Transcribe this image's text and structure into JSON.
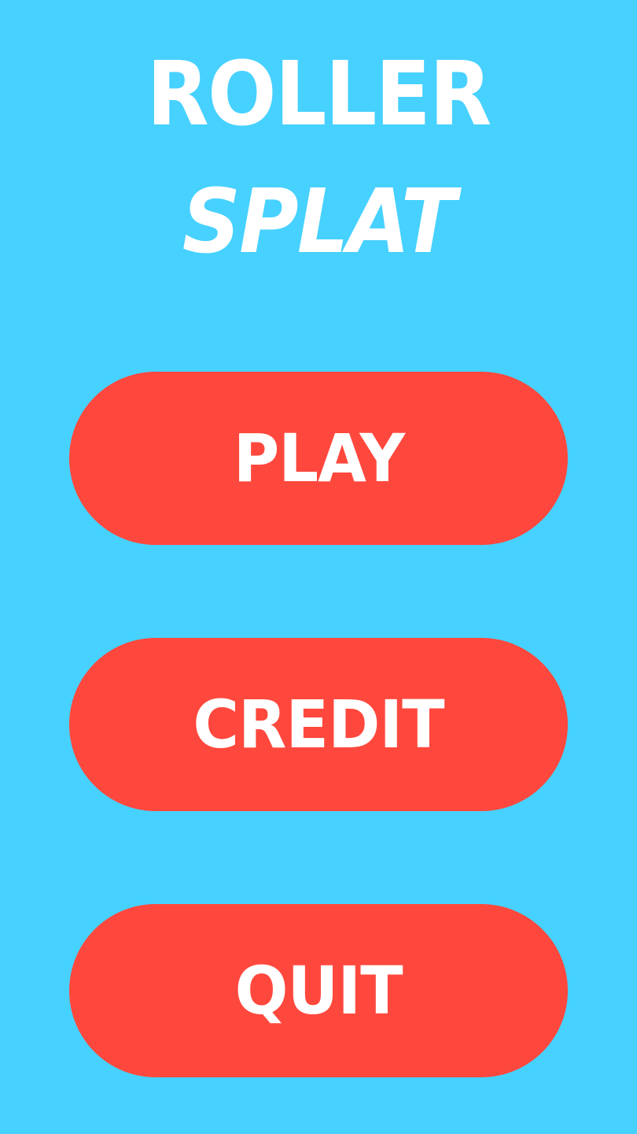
{
  "game": {
    "title_line_1": "ROLLER",
    "title_line_2": "SPLAT"
  },
  "menu": {
    "play_label": "PLAY",
    "credit_label": "CREDIT",
    "quit_label": "QUIT"
  },
  "colors": {
    "background": "#47D1FF",
    "button": "#FF483D",
    "text": "#FFFFFF"
  }
}
